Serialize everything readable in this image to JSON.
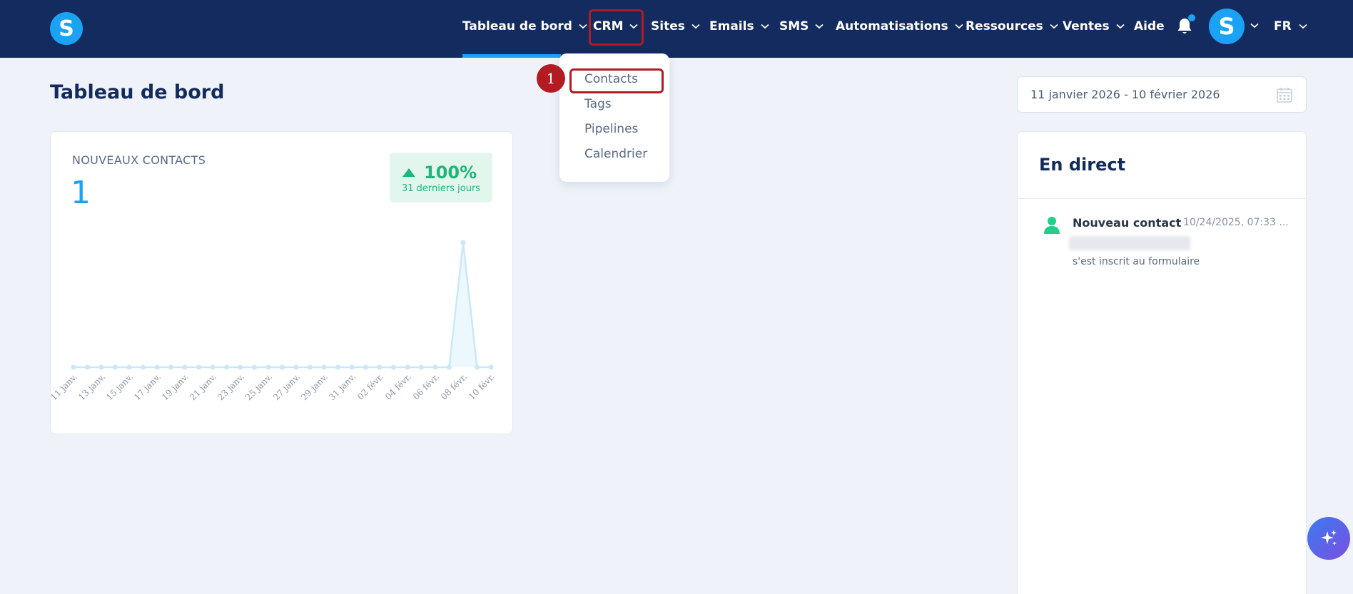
{
  "nav": {
    "items": [
      {
        "label": "Tableau de bord"
      },
      {
        "label": "CRM"
      },
      {
        "label": "Sites"
      },
      {
        "label": "Emails"
      },
      {
        "label": "SMS"
      },
      {
        "label": "Automatisations"
      },
      {
        "label": "Ressources"
      },
      {
        "label": "Ventes"
      },
      {
        "label": "Aide"
      }
    ],
    "logo_letter": "S",
    "avatar_letter": "S",
    "language": "FR"
  },
  "page": {
    "title": "Tableau de bord",
    "date_range": "11 janvier 2026 - 10 février 2026"
  },
  "crm_menu": {
    "items": [
      {
        "label": "Contacts"
      },
      {
        "label": "Tags"
      },
      {
        "label": "Pipelines"
      },
      {
        "label": "Calendrier"
      }
    ],
    "step_number": "1"
  },
  "new_contacts": {
    "label": "NOUVEAUX CONTACTS",
    "count": "1",
    "change_pct": "100%",
    "change_period": "31 derniers jours"
  },
  "chart_data": {
    "type": "area",
    "x": [
      "11 janv.",
      "12 janv.",
      "13 janv.",
      "14 janv.",
      "15 janv.",
      "16 janv.",
      "17 janv.",
      "18 janv.",
      "19 janv.",
      "20 janv.",
      "21 janv.",
      "22 janv.",
      "23 janv.",
      "24 janv.",
      "25 janv.",
      "26 janv.",
      "27 janv.",
      "28 janv.",
      "29 janv.",
      "30 janv.",
      "31 janv.",
      "01 févr.",
      "02 févr.",
      "03 févr.",
      "04 févr.",
      "05 févr.",
      "06 févr.",
      "07 févr.",
      "08 févr.",
      "09 févr.",
      "10 févr."
    ],
    "tick_labels": [
      "11 janv.",
      "13 janv.",
      "15 janv.",
      "17 janv.",
      "19 janv.",
      "21 janv.",
      "23 janv.",
      "25 janv.",
      "27 janv.",
      "29 janv.",
      "31 janv.",
      "02 févr.",
      "04 févr.",
      "06 févr.",
      "08 févr.",
      "10 févr."
    ],
    "values": [
      0,
      0,
      0,
      0,
      0,
      0,
      0,
      0,
      0,
      0,
      0,
      0,
      0,
      0,
      0,
      0,
      0,
      0,
      0,
      0,
      0,
      0,
      0,
      0,
      0,
      0,
      0,
      0,
      1,
      0,
      0
    ],
    "ylim": [
      0,
      1
    ],
    "grid": false,
    "color": "#1aa3f5"
  },
  "live": {
    "title": "En direct",
    "entries": [
      {
        "title": "Nouveau contact",
        "time": "10/24/2025, 07:33 ...",
        "description": "s'est inscrit au formulaire"
      }
    ]
  },
  "colors": {
    "nav_bg": "#142b60",
    "accent": "#1aa3f5",
    "success": "#1eb67a",
    "highlight": "#b31b22"
  }
}
